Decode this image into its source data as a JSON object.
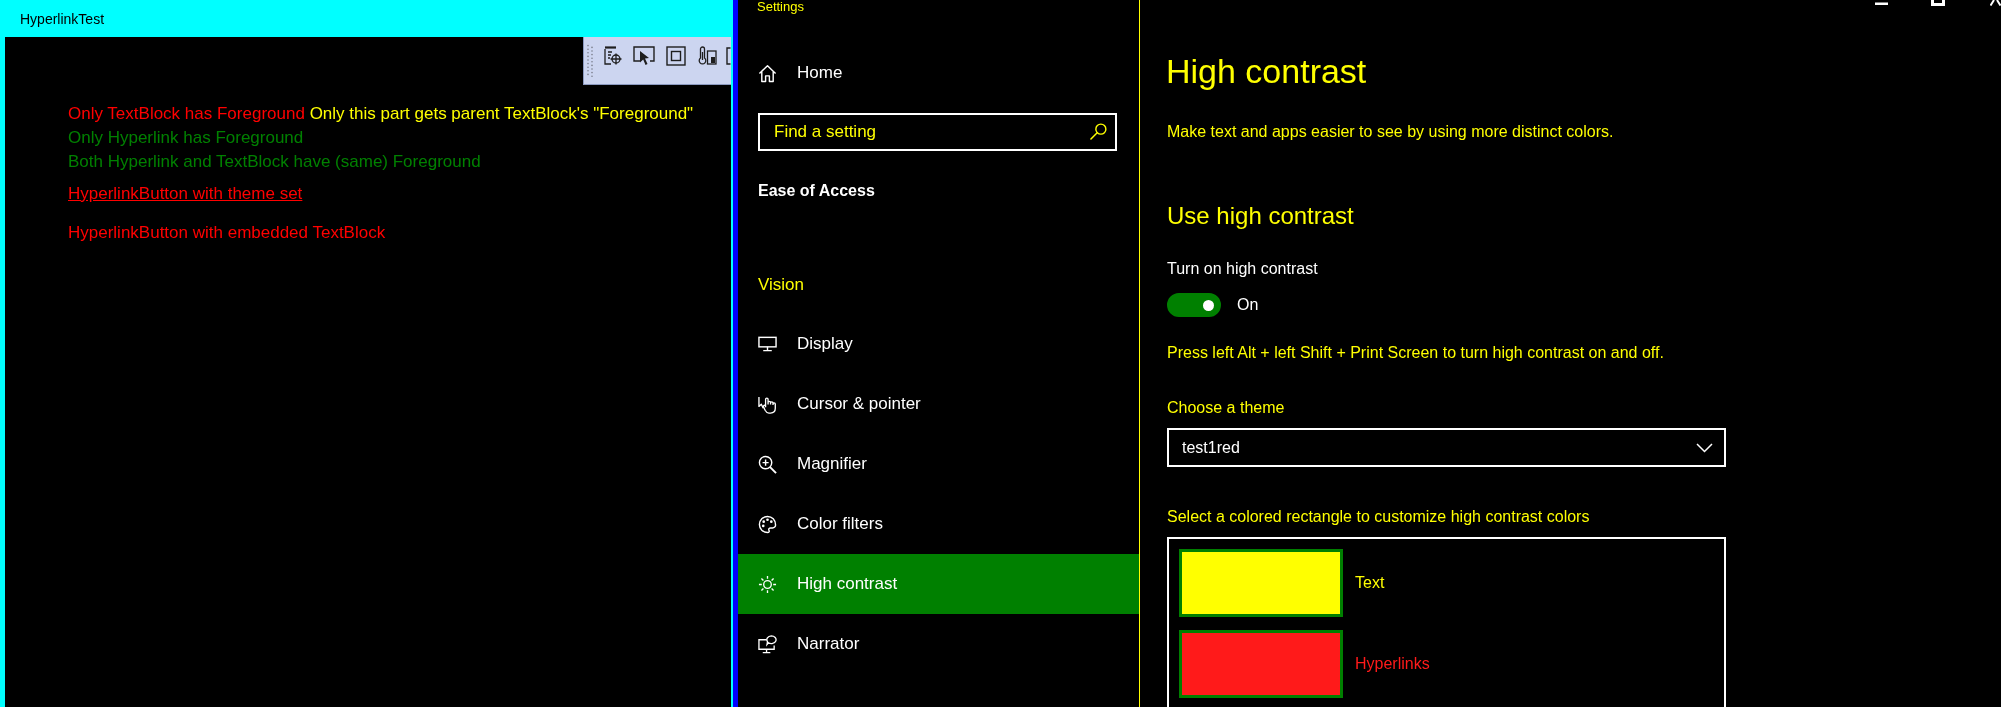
{
  "hyperlink_test": {
    "title": "HyperlinkTest",
    "lines": [
      {
        "kind": "text",
        "underlined": false,
        "segments": [
          {
            "text": "Only TextBlock has Foreground",
            "color": "#ff0000"
          },
          {
            "text": "Only this part gets parent TextBlock's \"Foreground\"",
            "color": "#ffff00"
          }
        ]
      },
      {
        "kind": "text",
        "underlined": false,
        "segments": [
          {
            "text": "Only Hyperlink has Foreground",
            "color": "#008000"
          }
        ]
      },
      {
        "kind": "text",
        "underlined": false,
        "segments": [
          {
            "text": "Both Hyperlink and TextBlock have (same) Foreground",
            "color": "#008000"
          }
        ]
      },
      {
        "kind": "hyperlink_button",
        "underlined": true,
        "segments": [
          {
            "text": "HyperlinkButton with theme set",
            "color": "#ff0000"
          }
        ]
      },
      {
        "kind": "hyperlink_button",
        "underlined": false,
        "segments": [
          {
            "text": "HyperlinkButton with embedded TextBlock",
            "color": "#ff0000"
          }
        ]
      }
    ]
  },
  "settings": {
    "title": "Settings",
    "sidebar": {
      "home": "Home",
      "search": {
        "placeholder": "Find a setting"
      },
      "section": "Ease of Access",
      "group": "Vision",
      "items": [
        {
          "label": "Display",
          "selected": false
        },
        {
          "label": "Cursor & pointer",
          "selected": false
        },
        {
          "label": "Magnifier",
          "selected": false
        },
        {
          "label": "Color filters",
          "selected": false
        },
        {
          "label": "High contrast",
          "selected": true
        },
        {
          "label": "Narrator",
          "selected": false
        }
      ]
    },
    "page": {
      "heading": "High contrast",
      "description": "Make text and apps easier to see by using more distinct colors.",
      "section_heading": "Use high contrast",
      "toggle": {
        "label": "Turn on high contrast",
        "on": true,
        "state_text": "On"
      },
      "hint": "Press left Alt + left Shift + Print Screen to turn high contrast on and off.",
      "theme": {
        "label": "Choose a theme",
        "value": "test1red"
      },
      "colors": {
        "label": "Select a colored rectangle to customize high contrast colors",
        "items": [
          {
            "label": "Text",
            "color": "#ffff00"
          },
          {
            "label": "Hyperlinks",
            "color": "#ff1a1a"
          }
        ]
      }
    }
  }
}
